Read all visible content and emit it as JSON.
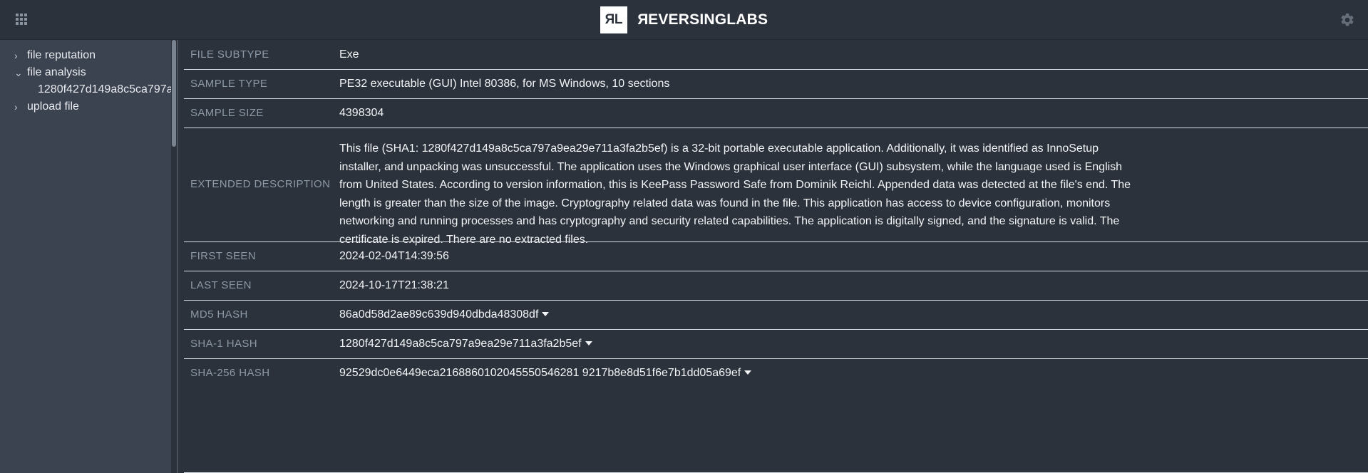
{
  "header": {
    "apps_icon": "grid-apps-icon",
    "settings_icon": "gear-icon",
    "brand_mark": "ЯL",
    "brand_name": "ЯEVERSINGLABS"
  },
  "sidebar": {
    "items": [
      {
        "label": "file reputation",
        "icon": "chevron-right-icon",
        "expanded": false
      },
      {
        "label": "file analysis",
        "icon": "chevron-down-icon",
        "expanded": true
      },
      {
        "label": "1280f427d149a8c5ca797a",
        "icon": "none",
        "leaf": true
      },
      {
        "label": "upload file",
        "icon": "chevron-right-icon",
        "expanded": false
      }
    ]
  },
  "main": {
    "rows": [
      {
        "label": "FILE SUBTYPE",
        "value": "Exe",
        "caret": false
      },
      {
        "label": "SAMPLE TYPE",
        "value": "PE32 executable (GUI) Intel 80386, for MS Windows, 10 sections",
        "caret": false
      },
      {
        "label": "SAMPLE SIZE",
        "value": "4398304",
        "caret": false
      },
      {
        "label": "FIRST SEEN",
        "value": "2024-02-04T14:39:56",
        "caret": false
      },
      {
        "label": "LAST SEEN",
        "value": "2024-10-17T21:38:21",
        "caret": false
      },
      {
        "label": "MD5 HASH",
        "value": "86a0d58d2ae89c639d940dbda48308df",
        "caret": true
      },
      {
        "label": "SHA-1 HASH",
        "value": "1280f427d149a8c5ca797a9ea29e711a3fa2b5ef",
        "caret": true
      },
      {
        "label": "SHA-256 HASH",
        "value": "92529dc0e6449eca2168860102045550546281 9217b8e8d51f6e7b1dd05a69ef",
        "caret": true
      }
    ],
    "description": {
      "label": "EXTENDED DESCRIPTION",
      "lines": [
        "This file (SHA1: 1280f427d149a8c5ca797a9ea29e711a3fa2b5ef) is a 32-bit portable executable application. Additionally, it was identified as InnoSetup",
        "installer, and unpacking was unsuccessful. The application uses the Windows graphical user interface (GUI) subsystem, while the language used is English",
        "from United States. According to version information, this is KeePass Password Safe from Dominik Reichl. Appended data was detected at the file's end. The",
        "length is greater than the size of the image. Cryptography related data was found in the file. This application has access to device configuration, monitors",
        "networking and running processes and has cryptography and security related capabilities. The application is digitally signed, and the signature is valid. The",
        "certificate is expired. There are no extracted files."
      ]
    }
  },
  "colors": {
    "header_bg": "#2b323c",
    "sidebar_bg": "#3b4250",
    "content_bg": "#2b323c",
    "label_text": "#8d99a6",
    "value_text": "#f2f4f6",
    "divider": "#d7dbe0"
  }
}
